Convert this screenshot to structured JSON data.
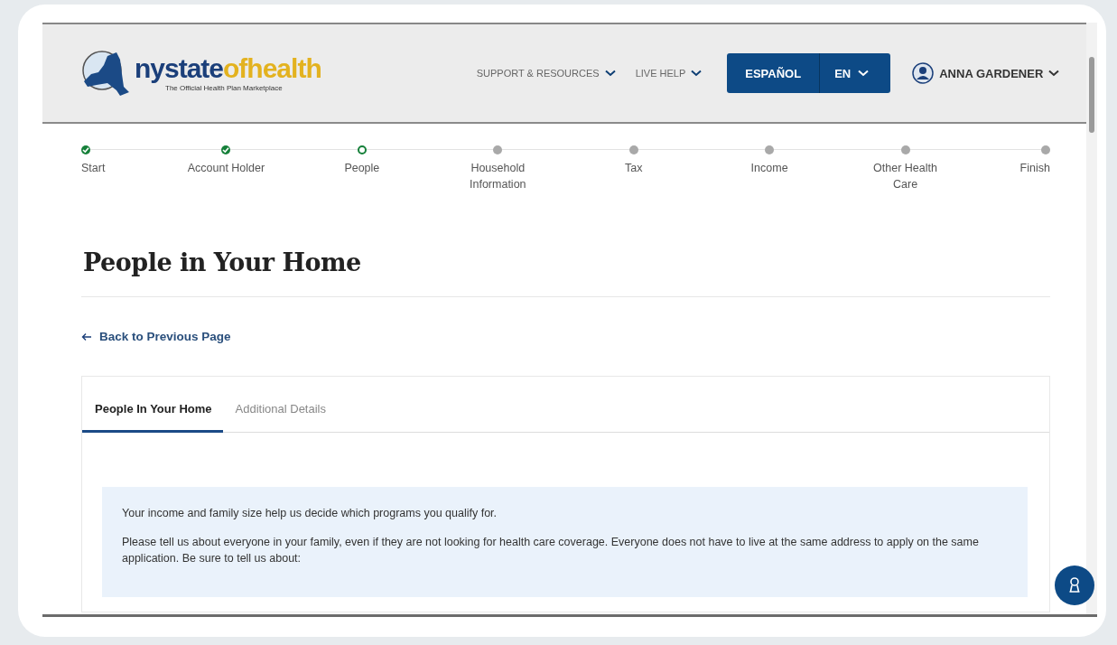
{
  "header": {
    "logo": {
      "name_first": "nystate",
      "name_second": "ofhealth",
      "tagline": "The Official Health Plan Marketplace"
    },
    "nav": [
      {
        "label": "SUPPORT & RESOURCES"
      },
      {
        "label": "LIVE HELP"
      }
    ],
    "language_buttons": [
      {
        "label": "ESPAÑOL",
        "kind": "button"
      },
      {
        "label": "EN",
        "kind": "dropdown"
      }
    ],
    "user": {
      "name": "ANNA GARDENER"
    }
  },
  "steps": [
    {
      "label": "Start",
      "completed": true,
      "current": false
    },
    {
      "label": "Account Holder",
      "completed": true,
      "current": false
    },
    {
      "label": "People",
      "completed": false,
      "current": true
    },
    {
      "label": "Household Information",
      "completed": false,
      "current": false
    },
    {
      "label": "Tax",
      "completed": false,
      "current": false
    },
    {
      "label": "Income",
      "completed": false,
      "current": false
    },
    {
      "label": "Other Health Care",
      "completed": false,
      "current": false
    },
    {
      "label": "Finish",
      "completed": false,
      "current": false
    }
  ],
  "page_title": "People in Your Home",
  "back_link": "Back to Previous Page",
  "tabs": [
    {
      "label": "People In Your Home",
      "selected": true
    },
    {
      "label": "Additional Details",
      "selected": false
    }
  ],
  "info": [
    "Your income and family size help us decide which programs you qualify for.",
    "Please tell us about everyone in your family, even if they are not looking for health care coverage. Everyone does not have to live at the same address to apply on the same application. Be sure to tell us about:"
  ]
}
